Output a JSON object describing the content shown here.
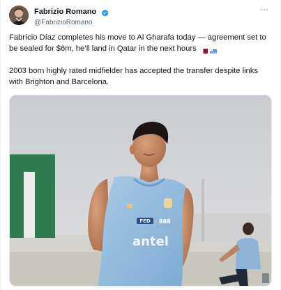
{
  "author": {
    "display_name": "Fabrizio Romano",
    "handle": "@FabrizioRomano",
    "verified": true,
    "avatar_icon": "profile-photo"
  },
  "menu": {
    "icon": "more-dots-icon",
    "label": "···"
  },
  "tweet": {
    "paragraph_1": "Fabrício Díaz completes his move to Al Gharafa today — agreement set to be sealed for $6m, he’ll land in Qatar in the next hours",
    "flags": [
      "qatar-flag",
      "uruguay-flag"
    ],
    "paragraph_2": "2003 born highly rated midfielder has accepted the transfer despite links with Brighton and Barcelona."
  },
  "media": {
    "description_icon": "player-training-photo",
    "shirt_sponsor": "antel",
    "shirt_badge": "FED"
  },
  "colors": {
    "verified_blue": "#1d9bf0",
    "text": "#0f1419",
    "secondary": "#536471",
    "shirt": "#8fbbe0"
  }
}
